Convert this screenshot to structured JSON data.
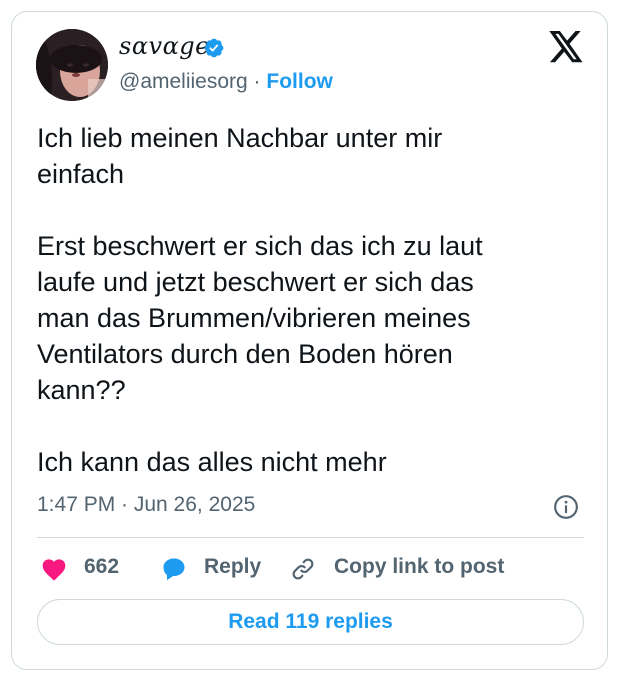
{
  "author": {
    "display_name": "sɑvɑge",
    "handle": "@ameliiesorg",
    "separator": "·",
    "follow_label": "Follow",
    "verified": true
  },
  "tweet": {
    "text": "Ich lieb meinen Nachbar unter mir\neinfach\n\nErst beschwert er sich das ich zu laut\nlaufe und jetzt beschwert er sich das\nman das Brummen/vibrieren meines\nVentilators durch den Boden hören\nkann??\n\nIch kann das alles nicht mehr",
    "timestamp": "1:47 PM · Jun 26, 2025"
  },
  "actions": {
    "like_count": "662",
    "reply_label": "Reply",
    "copy_link_label": "Copy link to post"
  },
  "read_replies_label": "Read 119 replies",
  "colors": {
    "accent": "#1d9bf0",
    "heart": "#f91880",
    "text": "#0f1419",
    "secondary": "#536471",
    "border": "#cfd9de"
  },
  "icons": [
    "verified-badge-icon",
    "x-logo-icon",
    "info-icon",
    "heart-icon",
    "reply-bubble-icon",
    "link-icon"
  ]
}
